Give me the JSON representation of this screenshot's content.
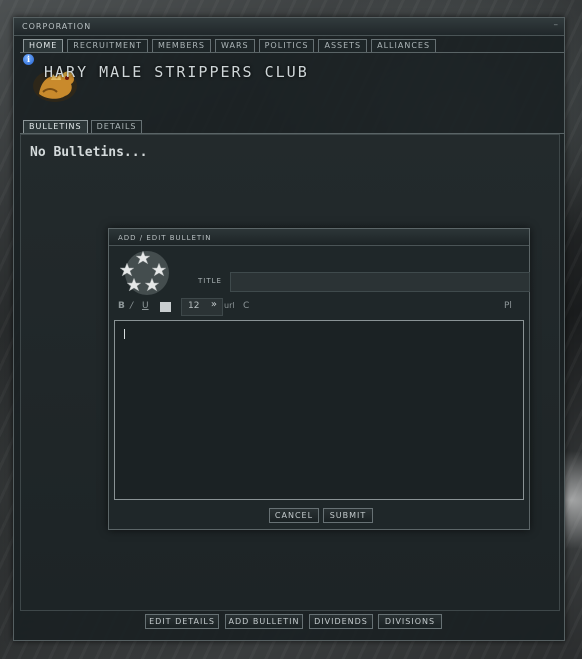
{
  "window": {
    "title": "CORPORATION",
    "minimize_glyph": "–"
  },
  "tabs": [
    {
      "label": "HOME",
      "active": true
    },
    {
      "label": "RECRUITMENT",
      "active": false
    },
    {
      "label": "MEMBERS",
      "active": false
    },
    {
      "label": "WARS",
      "active": false
    },
    {
      "label": "POLITICS",
      "active": false
    },
    {
      "label": "ASSETS",
      "active": false
    },
    {
      "label": "ALLIANCES",
      "active": false
    }
  ],
  "header": {
    "info_glyph": "i",
    "corp_name": "HARY MALE STRIPPERS CLUB",
    "logo_icon": "lion-logo-icon"
  },
  "subtabs": [
    {
      "label": "BULLETINS",
      "active": true
    },
    {
      "label": "DETAILS",
      "active": false
    }
  ],
  "content": {
    "empty_text": "No Bulletins..."
  },
  "dialog": {
    "title": "ADD / EDIT BULLETIN",
    "title_label": "TITLE",
    "title_value": "",
    "toolbar": {
      "bold": "B",
      "italic": "/",
      "underline": "U",
      "font_size": "12",
      "url": "url",
      "clear": "C",
      "right": "Pl"
    },
    "body_value": "",
    "cancel_label": "CANCEL",
    "submit_label": "SUBMIT"
  },
  "bottom_buttons": [
    {
      "label": "EDIT DETAILS"
    },
    {
      "label": "ADD BULLETIN"
    },
    {
      "label": "DIVIDENDS"
    },
    {
      "label": "DIVISIONS"
    }
  ],
  "colors": {
    "accent": "#8c9698",
    "info_blue": "#1e5fd0",
    "logo_gold": "#d9a13a"
  }
}
